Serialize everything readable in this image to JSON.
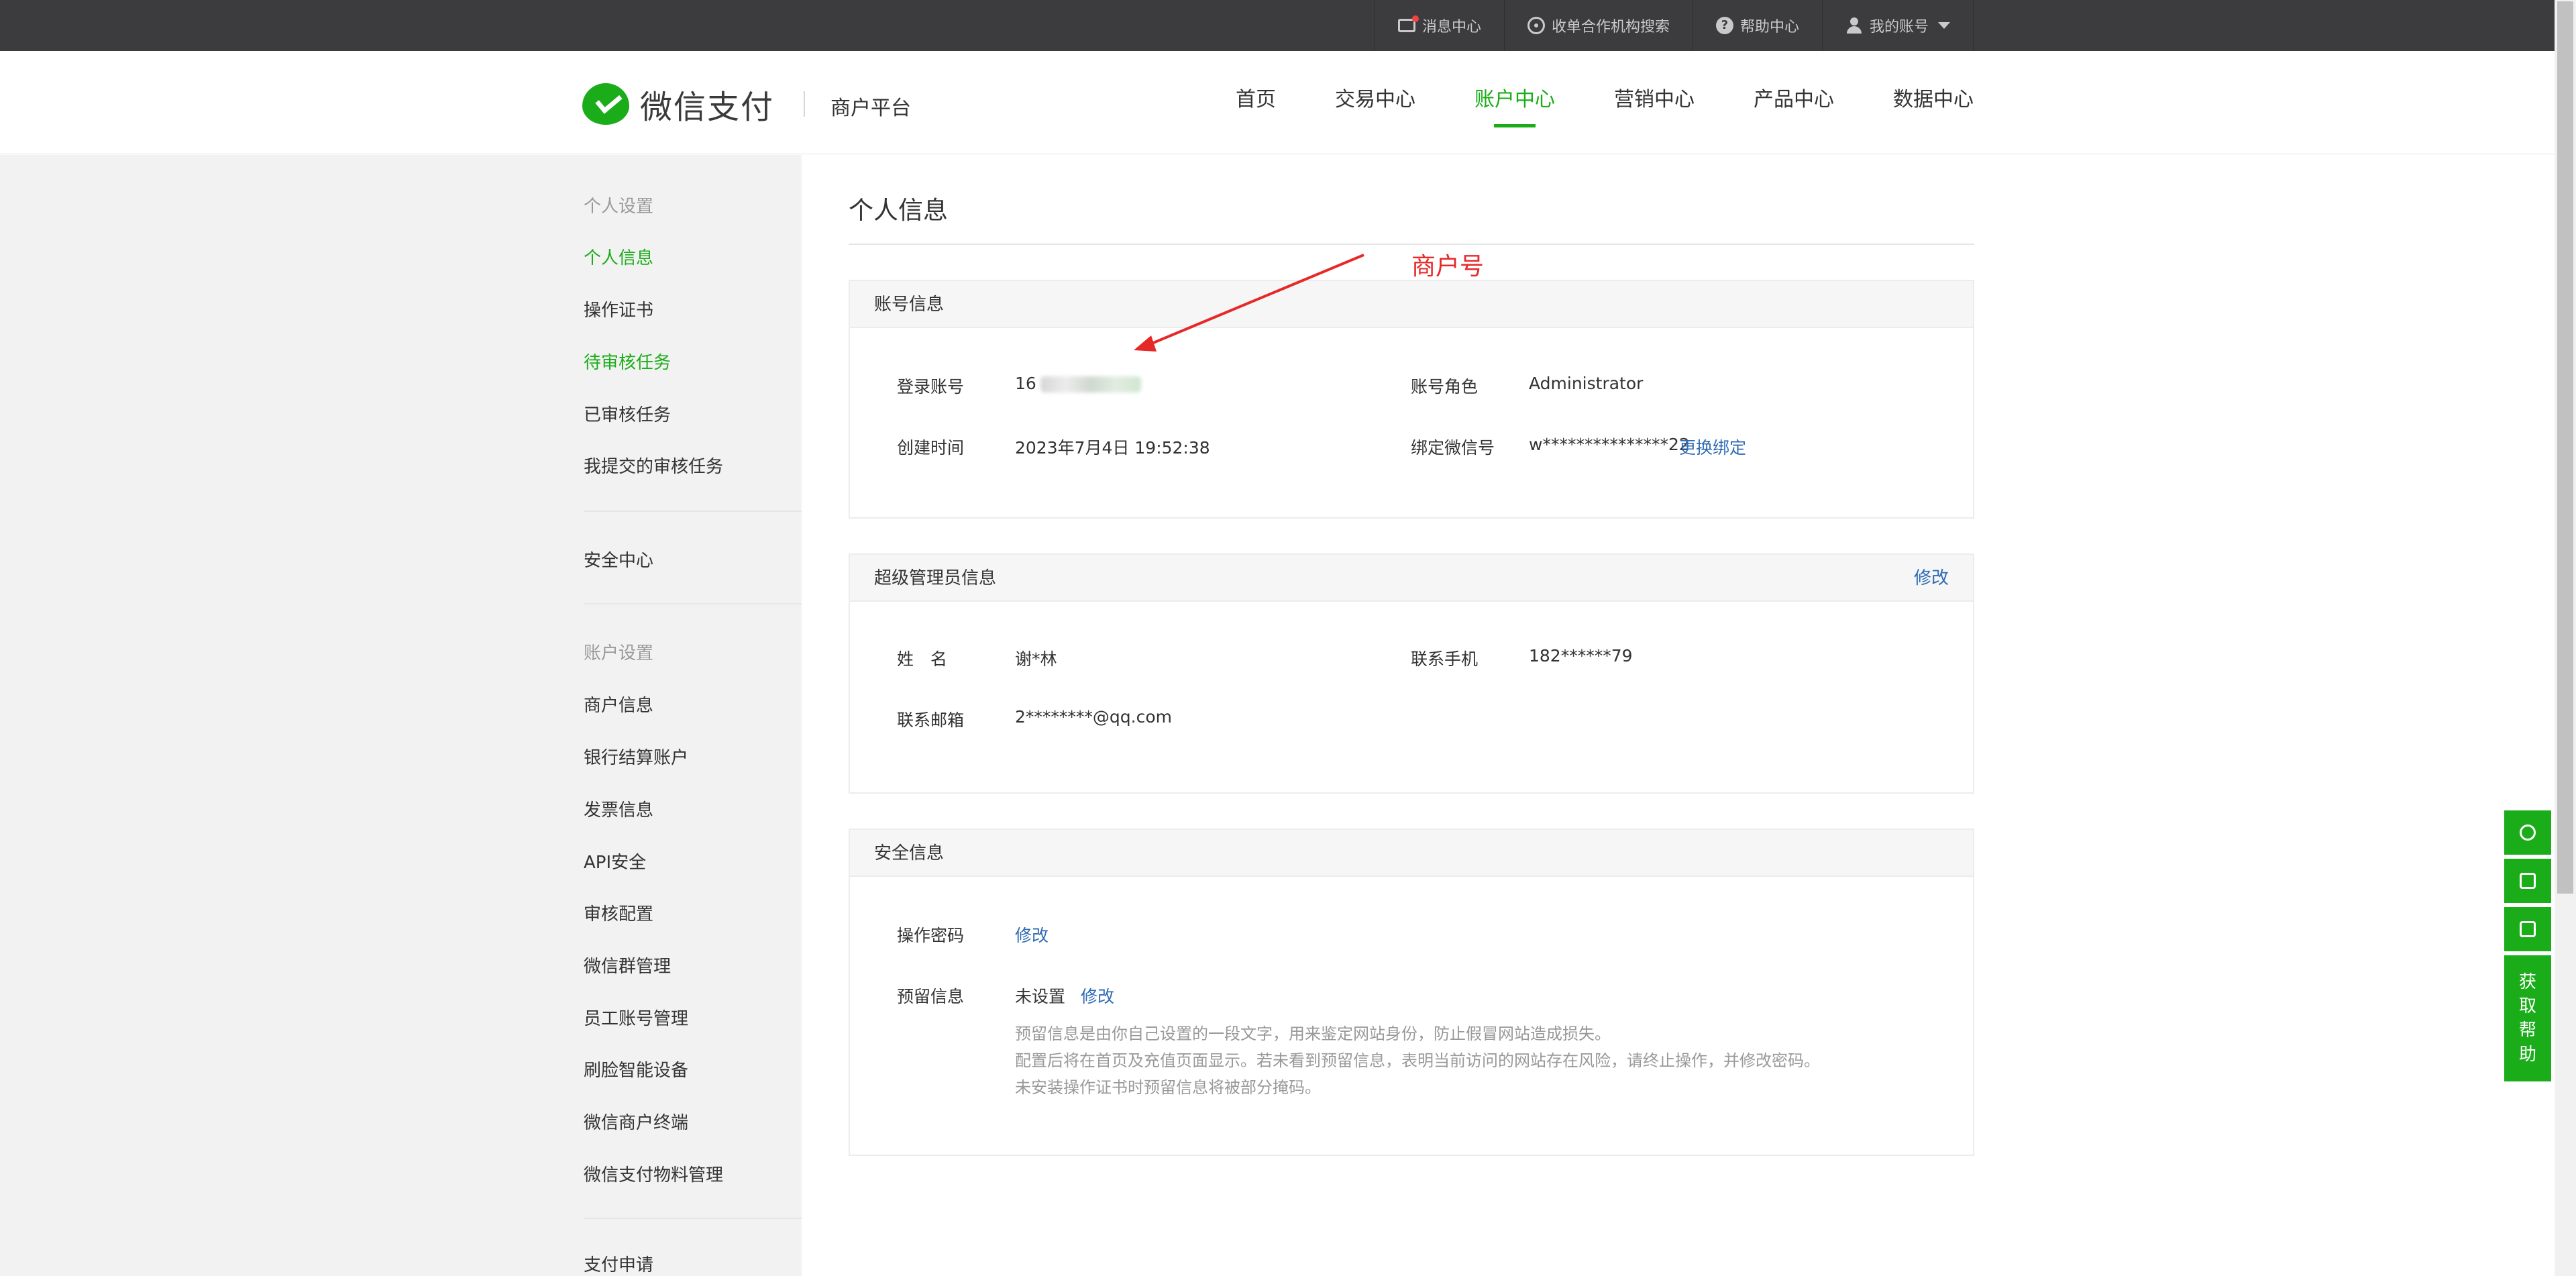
{
  "topbar": {
    "items": [
      {
        "label": "消息中心",
        "icon": "mail-icon"
      },
      {
        "label": "收单合作机构搜索",
        "icon": "search-icon"
      },
      {
        "label": "帮助中心",
        "icon": "help-icon"
      },
      {
        "label": "我的账号",
        "icon": "user-icon"
      }
    ],
    "help_glyph": "?"
  },
  "header": {
    "logo_text": "微信支付",
    "platform": "商户平台",
    "nav": [
      "首页",
      "交易中心",
      "账户中心",
      "营销中心",
      "产品中心",
      "数据中心"
    ],
    "active_nav": "账户中心",
    "accent_color": "#1aad19"
  },
  "sidebar": {
    "group1": "个人设置",
    "items1": [
      "个人信息",
      "操作证书",
      "待审核任务",
      "已审核任务",
      "我提交的审核任务"
    ],
    "security": "安全中心",
    "group2": "账户设置",
    "items2": [
      "商户信息",
      "银行结算账户",
      "发票信息",
      "API安全",
      "审核配置",
      "微信群管理",
      "员工账号管理",
      "刷脸智能设备",
      "微信商户终端",
      "微信支付物料管理"
    ],
    "apply": "支付申请"
  },
  "main": {
    "title": "个人信息",
    "account": {
      "header": "账号信息",
      "login_label": "登录账号",
      "login_value": "16",
      "role_label": "账号角色",
      "role_value": "Administrator",
      "created_label": "创建时间",
      "created_value": "2023年7月4日 19:52:38",
      "wechat_label": "绑定微信号",
      "wechat_value": "w***************22",
      "wechat_action": "更换绑定"
    },
    "admin": {
      "header": "超级管理员信息",
      "edit": "修改",
      "name_label": "姓　名",
      "name_value": "谢*林",
      "phone_label": "联系手机",
      "phone_value": "182******79",
      "email_label": "联系邮箱",
      "email_value": "2********@qq.com"
    },
    "security": {
      "header": "安全信息",
      "pwd_label": "操作密码",
      "pwd_action": "修改",
      "reserve_label": "预留信息",
      "reserve_value": "未设置",
      "reserve_action": "修改",
      "notes": [
        "预留信息是由你自己设置的一段文字，用来鉴定网站身份，防止假冒网站造成损失。",
        "配置后将在首页及充值页面显示。若未看到预留信息，表明当前访问的网站存在风险，请终止操作，并修改密码。",
        "未安装操作证书时预留信息将被部分掩码。"
      ]
    }
  },
  "annotation": {
    "label": "商户号",
    "color": "#e62828"
  },
  "float": {
    "help_chars": [
      "获",
      "取",
      "帮",
      "助"
    ],
    "icons": [
      "link-icon",
      "download-icon",
      "edit-icon"
    ]
  }
}
